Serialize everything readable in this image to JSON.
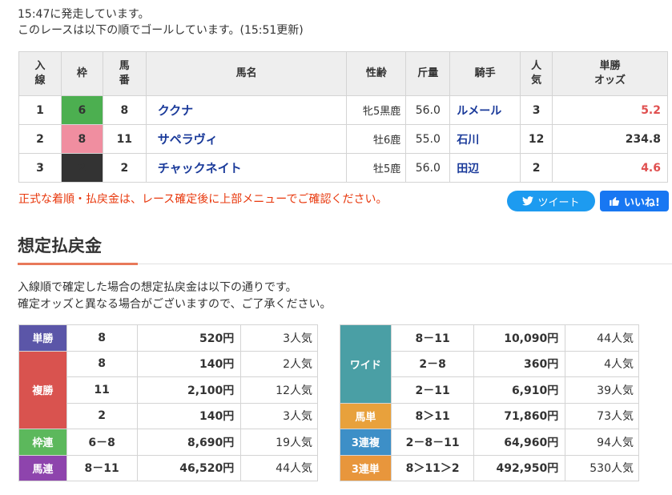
{
  "status": {
    "line1": "15:47に発走しています。",
    "line2": "このレースは以下の順でゴールしています。(15:51更新)"
  },
  "results": {
    "headers": {
      "order": "入\n線",
      "frame": "枠",
      "number": "馬\n番",
      "name": "馬名",
      "sex_age": "性齢",
      "weight": "斤量",
      "jockey": "騎手",
      "popularity": "人\n気",
      "win_odds": "単勝\nオッズ"
    },
    "rows": [
      {
        "order": "1",
        "frame": "6",
        "frame_color": "#4caf50",
        "number": "8",
        "name": "ククナ",
        "sex_age": "牝5黒鹿",
        "weight": "56.0",
        "jockey": "ルメール",
        "popularity": "3",
        "odds": "5.2",
        "odds_color": "#e05050"
      },
      {
        "order": "2",
        "frame": "8",
        "frame_color": "#f08ea0",
        "number": "11",
        "name": "サペラヴィ",
        "sex_age": "牡6鹿",
        "weight": "55.0",
        "jockey": "石川",
        "popularity": "12",
        "odds": "234.8",
        "odds_color": "#333333"
      },
      {
        "order": "3",
        "frame": "2",
        "frame_color": "#333333",
        "number": "2",
        "name": "チャックネイト",
        "sex_age": "牡5鹿",
        "weight": "56.0",
        "jockey": "田辺",
        "popularity": "2",
        "odds": "4.6",
        "odds_color": "#e05050"
      }
    ]
  },
  "notice": "正式な着順・払戻金は、レース確定後に上部メニューでご確認ください。",
  "social": {
    "tweet_label": "ツイート",
    "like_label": "いいね!"
  },
  "payout": {
    "title": "想定払戻金",
    "desc_line1": "入線順で確定した場合の想定払戻金は以下の通りです。",
    "desc_line2": "確定オッズと異なる場合がございますので、ご了承ください。",
    "left": [
      {
        "label": "単勝",
        "color": "#5b56a8",
        "rows": [
          {
            "combo": "8",
            "amount": "520円",
            "pop": "3人気"
          }
        ]
      },
      {
        "label": "複勝",
        "color": "#d9534f",
        "rows": [
          {
            "combo": "8",
            "amount": "140円",
            "pop": "2人気"
          },
          {
            "combo": "11",
            "amount": "2,100円",
            "pop": "12人気"
          },
          {
            "combo": "2",
            "amount": "140円",
            "pop": "3人気"
          }
        ]
      },
      {
        "label": "枠連",
        "color": "#5cb85c",
        "rows": [
          {
            "combo": "6－8",
            "amount": "8,690円",
            "pop": "19人気"
          }
        ]
      },
      {
        "label": "馬連",
        "color": "#8e44ad",
        "rows": [
          {
            "combo": "8－11",
            "amount": "46,520円",
            "pop": "44人気"
          }
        ]
      }
    ],
    "right": [
      {
        "label": "ワイド",
        "color": "#4a9fa5",
        "rows": [
          {
            "combo": "8－11",
            "amount": "10,090円",
            "pop": "44人気"
          },
          {
            "combo": "2－8",
            "amount": "360円",
            "pop": "4人気"
          },
          {
            "combo": "2－11",
            "amount": "6,910円",
            "pop": "39人気"
          }
        ]
      },
      {
        "label": "馬単",
        "color": "#e8a13c",
        "rows": [
          {
            "combo": "8＞11",
            "amount": "71,860円",
            "pop": "73人気"
          }
        ]
      },
      {
        "label": "3連複",
        "color": "#3d8fc7",
        "rows": [
          {
            "combo": "2－8－11",
            "amount": "64,960円",
            "pop": "94人気"
          }
        ]
      },
      {
        "label": "3連単",
        "color": "#e8963c",
        "rows": [
          {
            "combo": "8＞11＞2",
            "amount": "492,950円",
            "pop": "530人気"
          }
        ]
      }
    ]
  }
}
